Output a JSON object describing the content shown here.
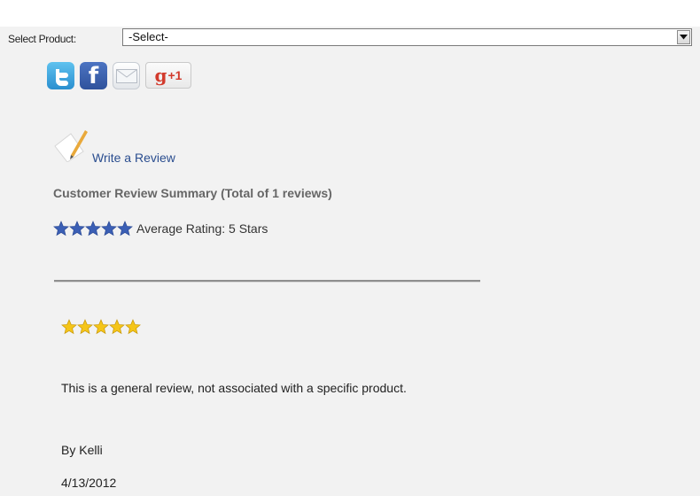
{
  "product_selector": {
    "label": "Select Product:",
    "selected": "-Select-"
  },
  "social": {
    "icons": [
      "twitter-icon",
      "facebook-icon",
      "email-icon",
      "google-plus-one-icon"
    ],
    "facebook_glyph": "f",
    "google_g": "g",
    "google_plus_one": "+1"
  },
  "write_review": {
    "label": "Write a Review"
  },
  "summary": {
    "title": "Customer Review Summary (Total of 1 reviews)",
    "average_text": "Average Rating: 5 Stars",
    "average_rating": 5,
    "average_star_color": "#3b5fb5"
  },
  "review": {
    "rating": 5,
    "star_color": "#f5c518",
    "text": "This is a general review, not associated with a specific product.",
    "author": "By Kelli",
    "date": "4/13/2012"
  }
}
